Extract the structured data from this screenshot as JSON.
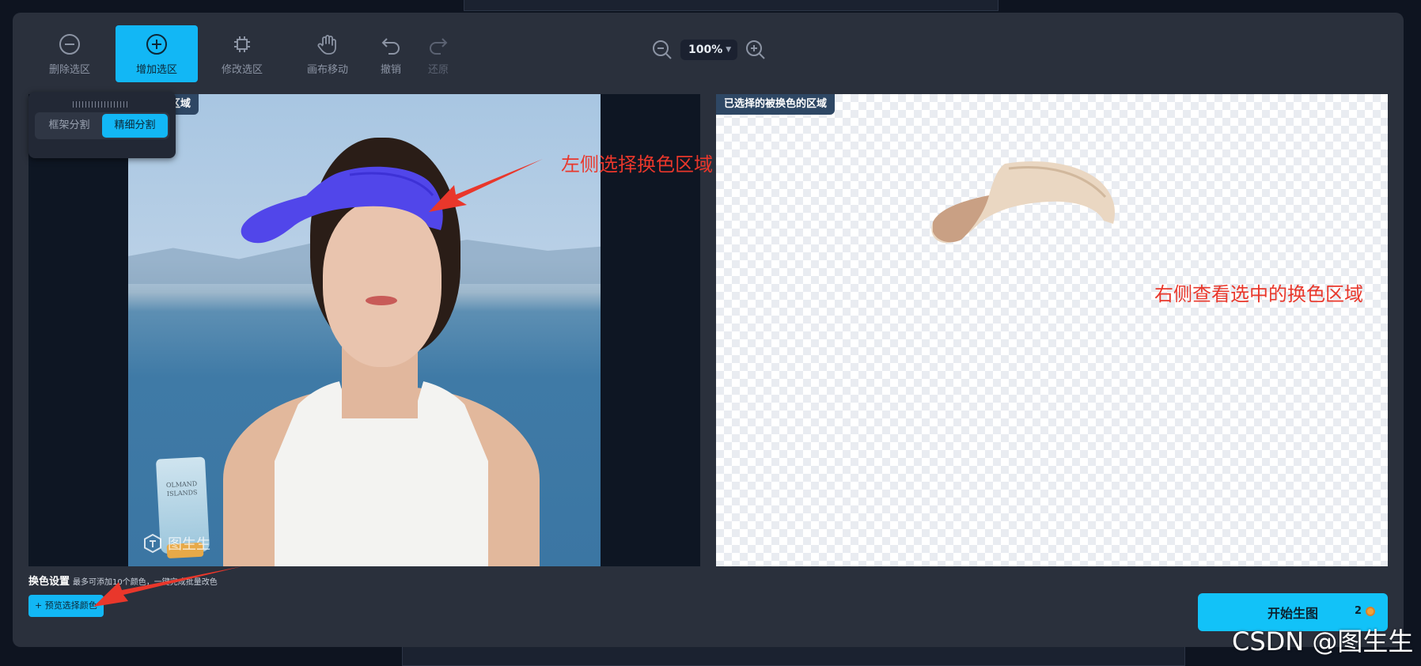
{
  "toolbar": {
    "tools": [
      {
        "label": "删除选区",
        "icon": "minus-circle-icon",
        "state": "normal"
      },
      {
        "label": "增加选区",
        "icon": "plus-circle-icon",
        "state": "active"
      },
      {
        "label": "修改选区",
        "icon": "chip-icon",
        "state": "normal"
      },
      {
        "label": "画布移动",
        "icon": "hand-icon",
        "state": "normal"
      },
      {
        "label": "撤销",
        "icon": "undo-icon",
        "state": "normal"
      },
      {
        "label": "还原",
        "icon": "redo-icon",
        "state": "disabled"
      }
    ],
    "zoom": {
      "value": "100%"
    }
  },
  "segment_popup": {
    "tabs": [
      "框架分割",
      "精细分割"
    ],
    "active_tab": "精细分割"
  },
  "left_panel": {
    "tag": "的区域"
  },
  "right_panel": {
    "tag": "已选择的被换色的区域"
  },
  "photo": {
    "bottle_text": "OLMAND ISLANDS",
    "watermark": "图生生"
  },
  "annotations": {
    "left": "左侧选择换色区域",
    "right": "右侧查看选中的换色区域"
  },
  "color_settings": {
    "title": "换色设置",
    "hint": "最多可添加10个颜色，一键完成批量改色"
  },
  "preview_button": {
    "label": "+ 预览选择颜色"
  },
  "start_button": {
    "label": "开始生图",
    "cost": "2"
  },
  "csdn_watermark": "CSDN @图生生",
  "colors": {
    "accent": "#12b7f5",
    "modal_bg": "#2a303c",
    "annotation_red": "#e9372b",
    "visor_blue": "#5146ea"
  }
}
